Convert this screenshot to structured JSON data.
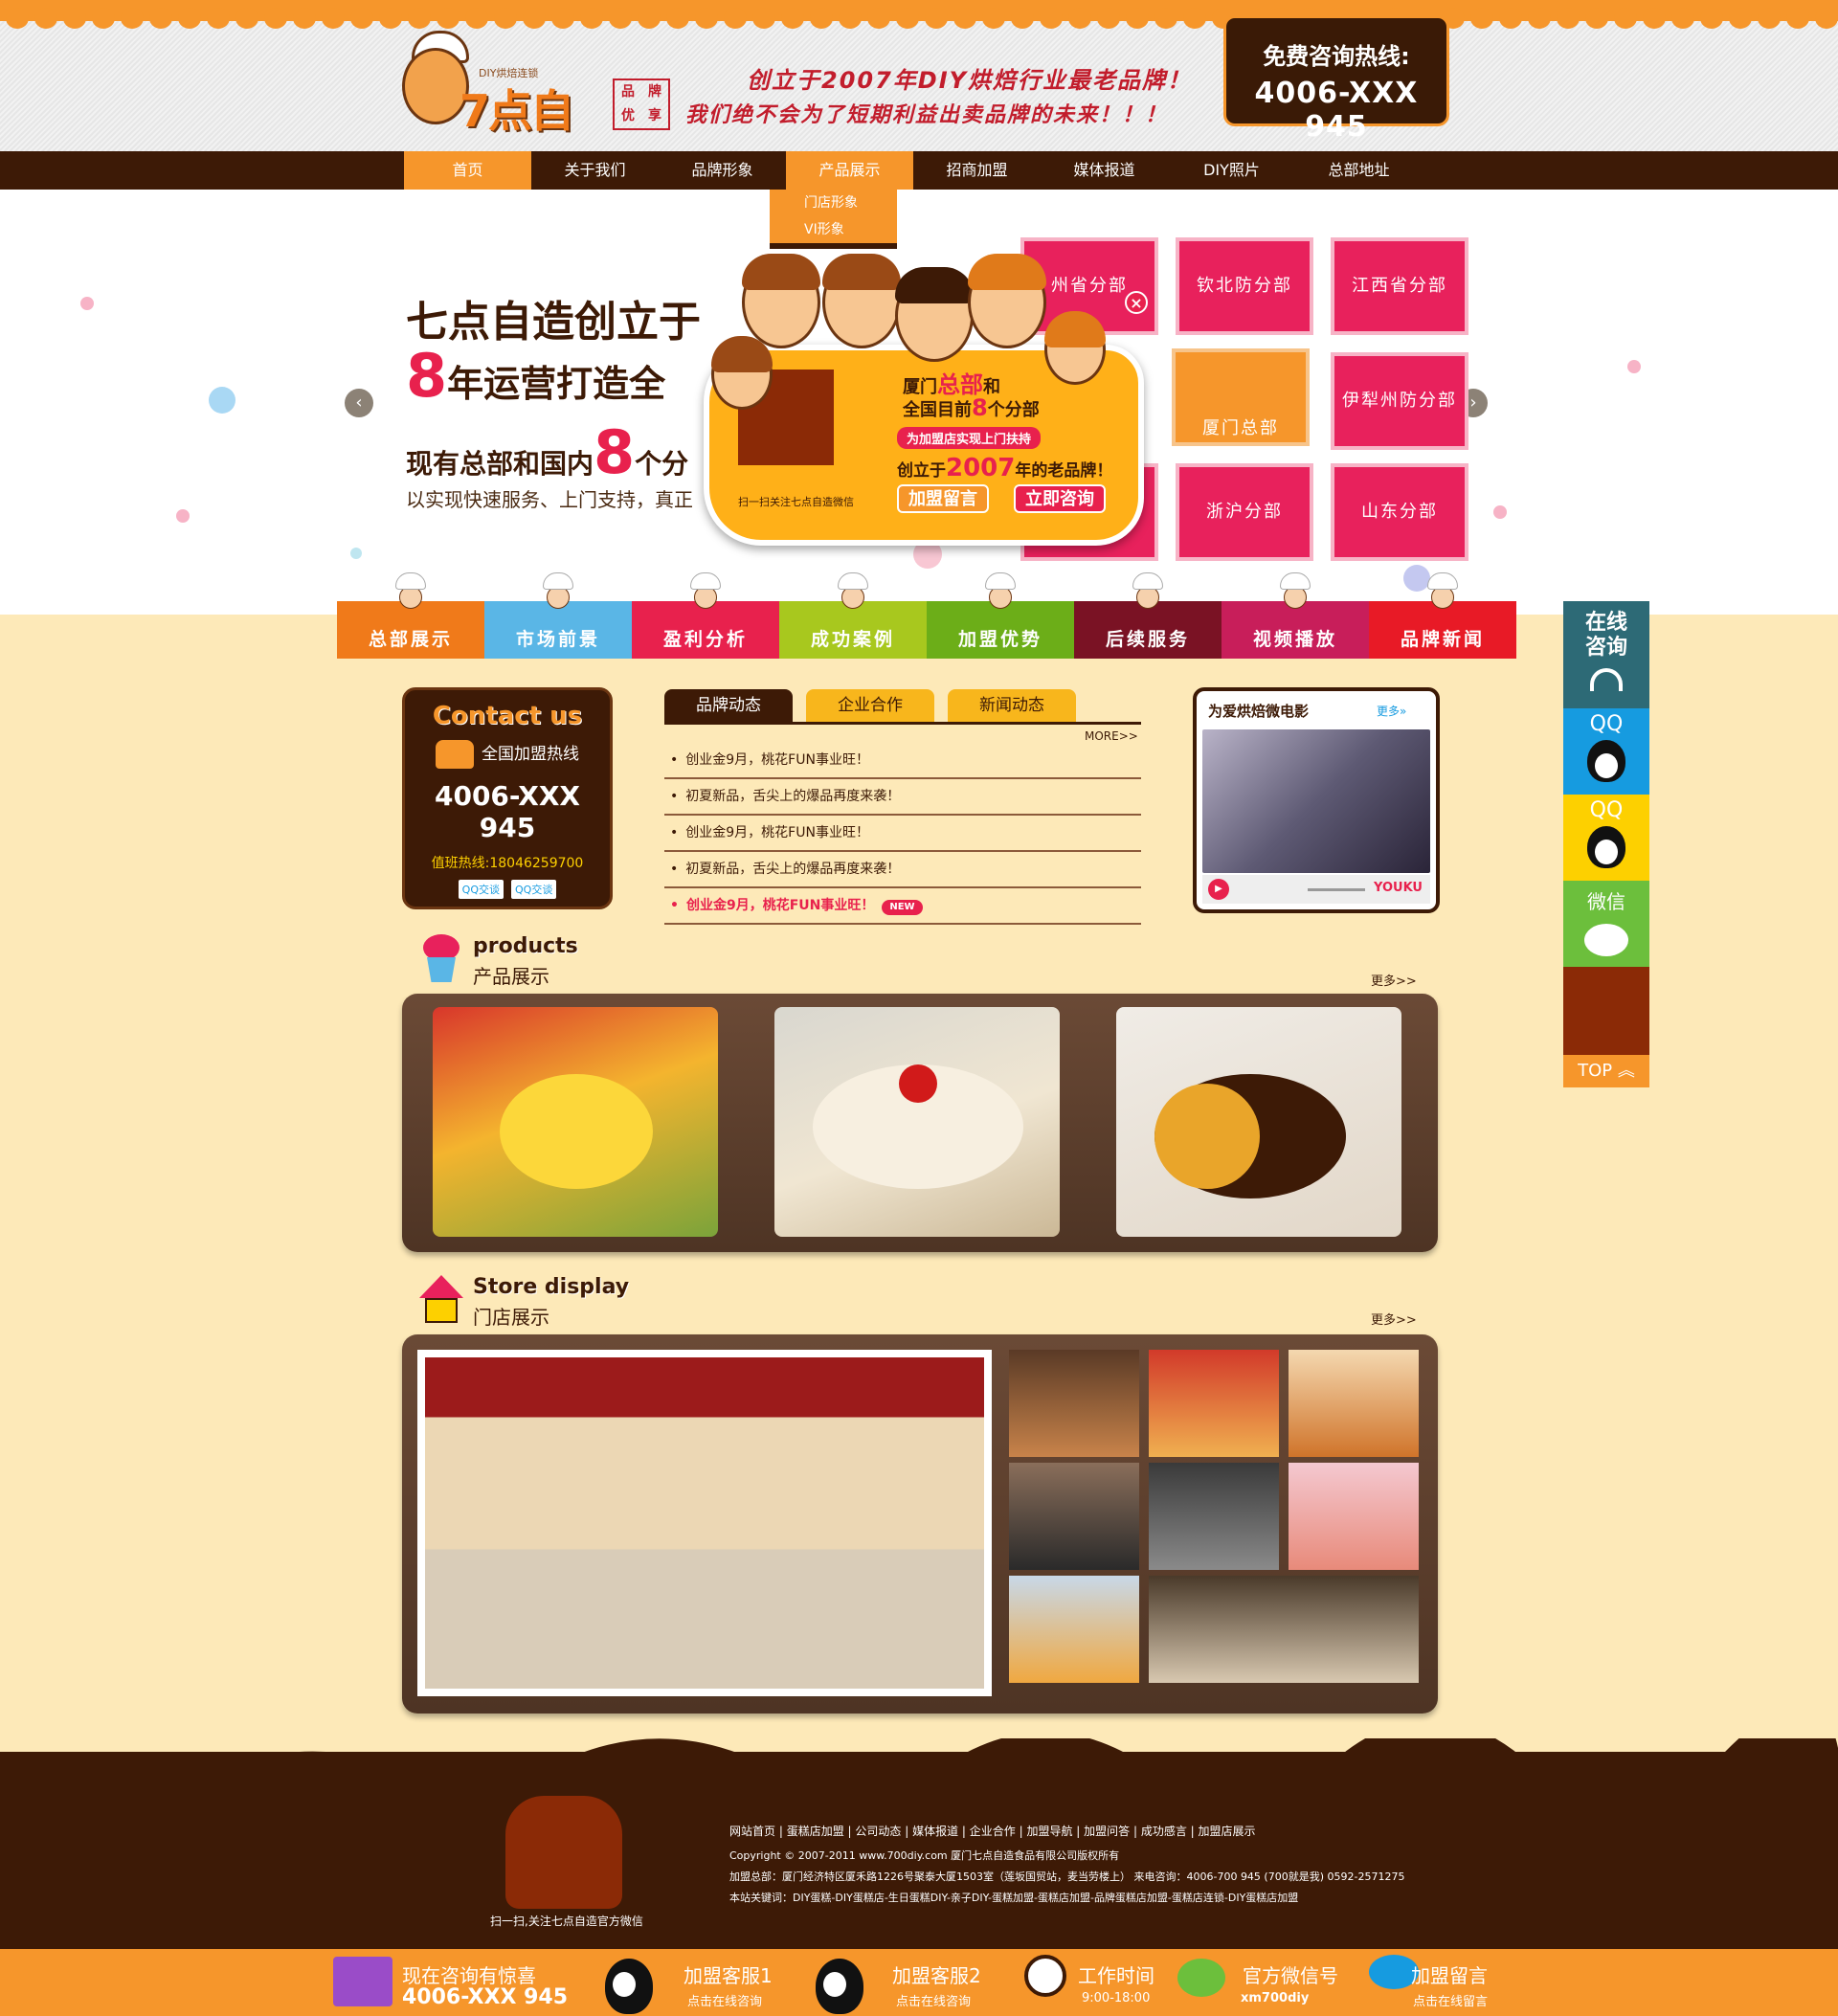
{
  "header": {
    "logo_small": "DIY烘焙连锁",
    "logo_brand": "7点自造",
    "seal": [
      "品",
      "牌",
      "优",
      "享"
    ],
    "slogan_line1": "创立于2007年DIY烘焙行业最老品牌！",
    "slogan_line2": "我们绝不会为了短期利益出卖品牌的未来！！！",
    "hotline_title": "免费咨询热线:",
    "hotline_number": "4006-XXX 945"
  },
  "nav": {
    "items": [
      "首页",
      "关于我们",
      "品牌形象",
      "产品展示",
      "招商加盟",
      "媒体报道",
      "DIY照片",
      "总部地址"
    ],
    "dropdown": [
      "门店形象",
      "VI形象"
    ]
  },
  "banner": {
    "line1": "七点自造创立于",
    "line2_big": "8",
    "line2": "年运营打造全",
    "line3_a": "现有总部和国内",
    "line3_big": "8",
    "line3_b": "个分",
    "line4": "以实现快速服务、上门支持，真正",
    "prev": "‹",
    "next": "›",
    "branches": [
      "州省分部",
      "钦北防分部",
      "江西省分部",
      "厦门总部",
      "伊犁州防分部",
      "浙沪分部",
      "山东分部"
    ]
  },
  "popup": {
    "qr_caption": "扫一扫关注七点自造微信",
    "l1_a": "厦门",
    "l1_b": "总部",
    "l1_c": "和",
    "l2_a": "全国目前",
    "l2_b": "8",
    "l2_c": "个分部",
    "l3": "为加盟店实现上门扶持",
    "l4_a": "创立于",
    "l4_b": "2007",
    "l4_c": "年的老品牌！",
    "btn_message": "加盟留言",
    "btn_consult": "立即咨询",
    "close": "×"
  },
  "categories": [
    {
      "label": "总部展示",
      "color": "#f07a1a"
    },
    {
      "label": "市场前景",
      "color": "#5ab6e6"
    },
    {
      "label": "盈利分析",
      "color": "#e8214d"
    },
    {
      "label": "成功案例",
      "color": "#a8c81e"
    },
    {
      "label": "加盟优势",
      "color": "#6cae18"
    },
    {
      "label": "后续服务",
      "color": "#7a1224"
    },
    {
      "label": "视频播放",
      "color": "#c81e5a"
    },
    {
      "label": "品牌新闻",
      "color": "#e81a26"
    }
  ],
  "side": {
    "online": "在线咨询",
    "qq1": "QQ",
    "qq2": "QQ",
    "wechat": "微信",
    "top": "TOP ︽"
  },
  "contact": {
    "title": "Contact us",
    "line": "全国加盟热线",
    "number": "4006-XXX 945",
    "duty": "值班热线:18046259700",
    "qq_buttons": [
      "QQ交谈",
      "QQ交谈"
    ]
  },
  "news": {
    "tabs": [
      "品牌动态",
      "企业合作",
      "新闻动态"
    ],
    "more": "MORE>>",
    "items": [
      "创业金9月，桃花FUN事业旺！",
      "初夏新品，舌尖上的爆品再度来袭！",
      "创业金9月，桃花FUN事业旺！",
      "初夏新品，舌尖上的爆品再度来袭！",
      "创业金9月，桃花FUN事业旺！"
    ],
    "new_badge": "NEW"
  },
  "video": {
    "title": "为爱烘焙微电影",
    "more": "更多»",
    "brand": "YOUKU"
  },
  "products": {
    "en": "products",
    "cn": "产品展示",
    "more": "更多>>"
  },
  "store": {
    "en": "Store display",
    "cn": "门店展示",
    "more": "更多>>"
  },
  "footer": {
    "qr_caption": "扫一扫,关注七点自造官方微信",
    "links": [
      "网站首页",
      "蛋糕店加盟",
      "公司动态",
      "媒体报道",
      "企业合作",
      "加盟导航",
      "加盟问答",
      "成功感言",
      "加盟店展示"
    ],
    "copyright": "Copyright © 2007-2011 www.700diy.com 厦门七点自造食品有限公司版权所有",
    "address": "加盟总部：厦门经济特区厦禾路1226号聚泰大厦1503室（莲坂国贸站，麦当劳楼上） 来电咨询：4006-700 945 (700就是我) 0592-2571275",
    "keywords": "本站关键词：DIY蛋糕-DIY蛋糕店-生日蛋糕DIY-亲子DIY-蛋糕加盟-蛋糕店加盟-品牌蛋糕店加盟-蛋糕店连锁-DIY蛋糕店加盟"
  },
  "bottom_bar": {
    "gift_title": "现在咨询有惊喜",
    "gift_number": "4006-XXX 945",
    "svc1_title": "加盟客服1",
    "svc1_sub": "点击在线咨询",
    "svc2_title": "加盟客服2",
    "svc2_sub": "点击在线咨询",
    "time_title": "工作时间",
    "time_sub": "9:00-18:00",
    "wx_title": "官方微信号",
    "wx_sub": "xm700diy",
    "msg_title": "加盟留言",
    "msg_sub": "点击在线留言"
  },
  "colors": {
    "brown": "#3d1a06",
    "orange": "#f6962b",
    "pink": "#e8215c",
    "cream": "#fde9b8"
  }
}
